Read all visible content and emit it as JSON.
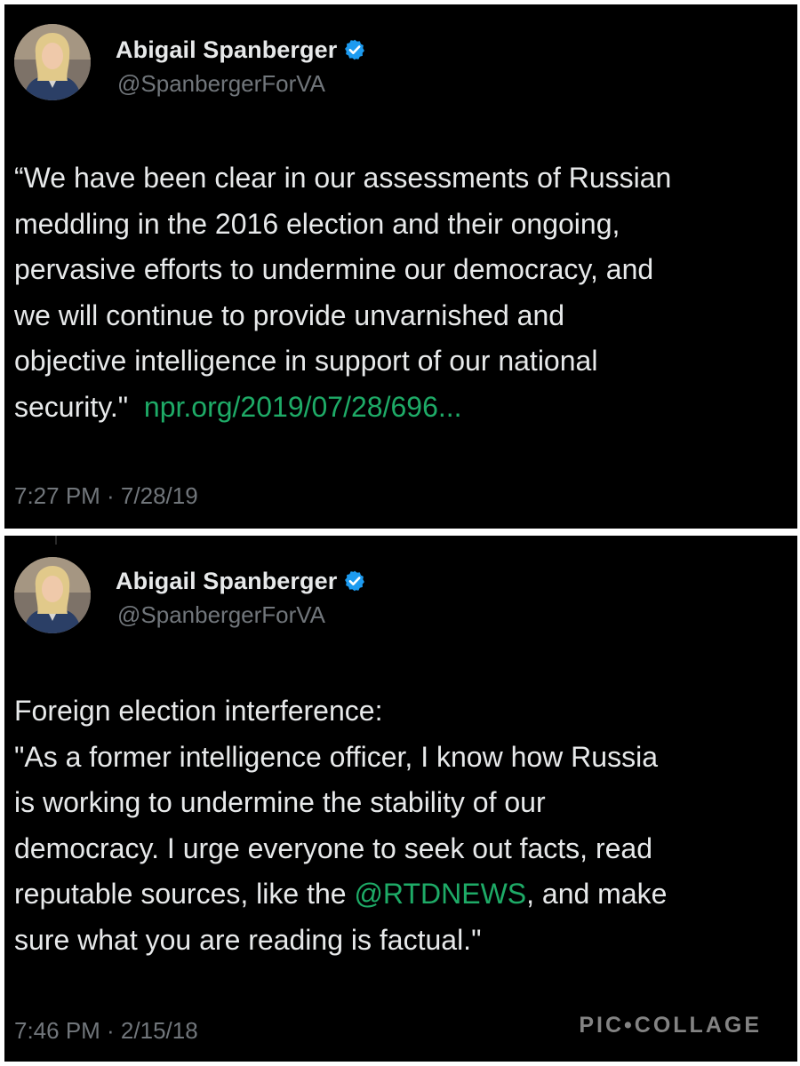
{
  "tweets": [
    {
      "author": {
        "display_name": "Abigail Spanberger",
        "handle": "@SpanbergerForVA",
        "verified": true
      },
      "text_before": "“We have been clear in our assessments of Russian\nmeddling in the 2016 election and their ongoing,\npervasive efforts to undermine our democracy, and\nwe will continue to provide unvarnished and\nobjective intelligence in support of our national\nsecurity.\"  ",
      "link_text": "npr.org/2019/07/28/696...",
      "time": "7:27 PM · 7/28/19"
    },
    {
      "author": {
        "display_name": "Abigail Spanberger",
        "handle": "@SpanbergerForVA",
        "verified": true
      },
      "text_before": "Foreign election interference:\n\"As a former intelligence officer, I know how Russia\nis working to undermine the stability of our\ndemocracy. I urge everyone to seek out facts, read\nreputable sources, like the ",
      "mention_text": "@RTDNEWS",
      "text_after": ", and make\nsure what you are reading is factual.\"",
      "time": "7:46 PM · 2/15/18"
    }
  ],
  "watermark": "PIC•COLLAGE",
  "colors": {
    "background": "#000000",
    "text": "#e7e9ea",
    "secondary": "#71767b",
    "link": "#1eab67",
    "verified": "#1d9bf0"
  },
  "icons": {
    "verified": "verified-badge-icon"
  }
}
